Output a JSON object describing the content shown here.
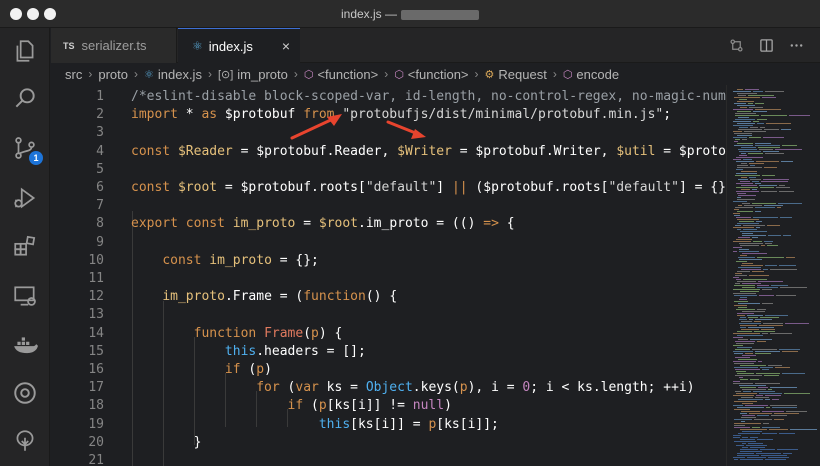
{
  "window": {
    "title": "index.js —"
  },
  "activity_bar": {
    "items": [
      {
        "name": "explorer-icon"
      },
      {
        "name": "search-icon"
      },
      {
        "name": "source-control-icon",
        "badge": "1"
      },
      {
        "name": "run-debug-icon"
      },
      {
        "name": "extensions-icon"
      },
      {
        "name": "remote-explorer-icon"
      },
      {
        "name": "docker-icon"
      },
      {
        "name": "circle-target-icon"
      },
      {
        "name": "tree-icon"
      }
    ]
  },
  "tabs": [
    {
      "prefix": "TS",
      "label": "serializer.ts",
      "active": false
    },
    {
      "label": "index.js",
      "active": true,
      "close": "×"
    }
  ],
  "breadcrumb": [
    {
      "label": "src",
      "icon": ""
    },
    {
      "label": "proto",
      "icon": ""
    },
    {
      "label": "index.js",
      "icon": "js"
    },
    {
      "label": "im_proto",
      "icon": "[⊙]"
    },
    {
      "label": "<function>",
      "icon": "cube"
    },
    {
      "label": "<function>",
      "icon": "cube"
    },
    {
      "label": "Request",
      "icon": "class"
    },
    {
      "label": "encode",
      "icon": "cube"
    }
  ],
  "code_lines": [
    {
      "n": "1",
      "tokens": [
        [
          "comment",
          "/*eslint-disable block-scoped-var, id-length, no-control-regex, no-magic-numbers,"
        ]
      ]
    },
    {
      "n": "2",
      "tokens": [
        [
          "kw",
          "import"
        ],
        [
          "plain",
          " * "
        ],
        [
          "kw",
          "as"
        ],
        [
          "plain",
          " $protobuf "
        ],
        [
          "kw",
          "from"
        ],
        [
          "plain",
          " "
        ],
        [
          "str",
          "\"protobufjs/dist/minimal/protobuf.min.js\""
        ],
        [
          "plain",
          ";"
        ]
      ]
    },
    {
      "n": "3",
      "tokens": []
    },
    {
      "n": "4",
      "tokens": [
        [
          "kw",
          "const"
        ],
        [
          "plain",
          " "
        ],
        [
          "prop",
          "$Reader"
        ],
        [
          "plain",
          " = $protobuf.Reader, "
        ],
        [
          "prop",
          "$Writer"
        ],
        [
          "plain",
          " = $protobuf.Writer, "
        ],
        [
          "prop",
          "$util"
        ],
        [
          "plain",
          " = $protobuf.u"
        ]
      ]
    },
    {
      "n": "5",
      "tokens": []
    },
    {
      "n": "6",
      "tokens": [
        [
          "kw",
          "const"
        ],
        [
          "plain",
          " "
        ],
        [
          "prop",
          "$root"
        ],
        [
          "plain",
          " = $protobuf.roots["
        ],
        [
          "str",
          "\"default\""
        ],
        [
          "plain",
          "] "
        ],
        [
          "kw",
          "||"
        ],
        [
          "plain",
          " ($protobuf.roots["
        ],
        [
          "str",
          "\"default\""
        ],
        [
          "plain",
          "] = {});"
        ]
      ]
    },
    {
      "n": "7",
      "tokens": []
    },
    {
      "n": "8",
      "tokens": [
        [
          "kw",
          "export"
        ],
        [
          "plain",
          " "
        ],
        [
          "kw",
          "const"
        ],
        [
          "plain",
          " "
        ],
        [
          "prop",
          "im_proto"
        ],
        [
          "plain",
          " = "
        ],
        [
          "prop",
          "$root"
        ],
        [
          "plain",
          ".im_proto = (() "
        ],
        [
          "kw",
          "=>"
        ],
        [
          "plain",
          " {"
        ]
      ]
    },
    {
      "n": "9",
      "tokens": []
    },
    {
      "n": "10",
      "tokens": [
        [
          "plain",
          "    "
        ],
        [
          "kw",
          "const"
        ],
        [
          "plain",
          " "
        ],
        [
          "prop",
          "im_proto"
        ],
        [
          "plain",
          " = {};"
        ]
      ]
    },
    {
      "n": "11",
      "tokens": []
    },
    {
      "n": "12",
      "tokens": [
        [
          "plain",
          "    "
        ],
        [
          "prop",
          "im_proto"
        ],
        [
          "plain",
          ".Frame = ("
        ],
        [
          "kw",
          "function"
        ],
        [
          "plain",
          "() {"
        ]
      ]
    },
    {
      "n": "13",
      "tokens": []
    },
    {
      "n": "14",
      "tokens": [
        [
          "plain",
          "        "
        ],
        [
          "kw",
          "function"
        ],
        [
          "plain",
          " "
        ],
        [
          "func",
          "Frame"
        ],
        [
          "plain",
          "("
        ],
        [
          "kw",
          "p"
        ],
        [
          "plain",
          ") {"
        ]
      ]
    },
    {
      "n": "15",
      "tokens": [
        [
          "plain",
          "            "
        ],
        [
          "this",
          "this"
        ],
        [
          "plain",
          ".headers = [];"
        ]
      ]
    },
    {
      "n": "16",
      "tokens": [
        [
          "plain",
          "            "
        ],
        [
          "kw",
          "if"
        ],
        [
          "plain",
          " ("
        ],
        [
          "kw",
          "p"
        ],
        [
          "plain",
          ")"
        ]
      ]
    },
    {
      "n": "17",
      "tokens": [
        [
          "plain",
          "                "
        ],
        [
          "kw",
          "for"
        ],
        [
          "plain",
          " ("
        ],
        [
          "kw",
          "var"
        ],
        [
          "plain",
          " ks = "
        ],
        [
          "this",
          "Object"
        ],
        [
          "plain",
          ".keys("
        ],
        [
          "kw",
          "p"
        ],
        [
          "plain",
          "), i = "
        ],
        [
          "num",
          "0"
        ],
        [
          "plain",
          "; i < ks.length; ++i)"
        ]
      ]
    },
    {
      "n": "18",
      "tokens": [
        [
          "plain",
          "                    "
        ],
        [
          "kw",
          "if"
        ],
        [
          "plain",
          " ("
        ],
        [
          "kw",
          "p"
        ],
        [
          "plain",
          "[ks[i]] != "
        ],
        [
          "num",
          "null"
        ],
        [
          "plain",
          ")"
        ]
      ]
    },
    {
      "n": "19",
      "tokens": [
        [
          "plain",
          "                        "
        ],
        [
          "this",
          "this"
        ],
        [
          "plain",
          "[ks[i]] = "
        ],
        [
          "kw",
          "p"
        ],
        [
          "plain",
          "[ks[i]];"
        ]
      ]
    },
    {
      "n": "20",
      "tokens": [
        [
          "plain",
          "        }"
        ]
      ]
    },
    {
      "n": "21",
      "tokens": []
    }
  ],
  "colors": {
    "accent": "#1d74d8",
    "arrow": "#e8442e"
  }
}
